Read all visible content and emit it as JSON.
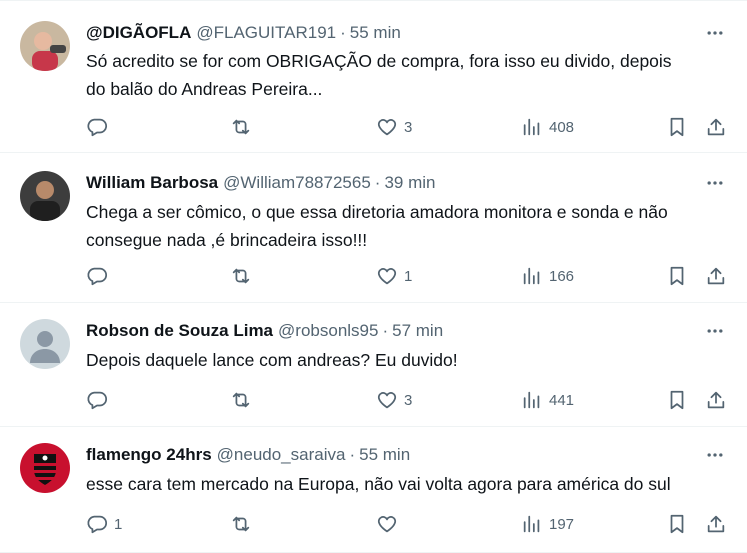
{
  "tweets": [
    {
      "name": "@DIGÃOFLA",
      "handle": "@FLAGUITAR191",
      "separator": "·",
      "time": "55 min",
      "lines": [
        "Só acredito se for com OBRIGAÇÃO de compra, fora isso eu divido, depois",
        "do balão do Andreas Pereira..."
      ],
      "replies": "",
      "retweets": "",
      "likes": "3",
      "views": "408",
      "avatar_colors": [
        "#c9b8a0",
        "#c7374a"
      ]
    },
    {
      "name": "William Barbosa",
      "handle": "@William78872565",
      "separator": "·",
      "time": "39 min",
      "lines": [
        "Chega a ser cômico, o que essa diretoria amadora monitora e sonda e não",
        "consegue nada ,é brincadeira isso!!!"
      ],
      "replies": "",
      "retweets": "",
      "likes": "1",
      "views": "166",
      "avatar_colors": [
        "#3d3d3d",
        "#1f1f1f"
      ]
    },
    {
      "name": "Robson de Souza Lima",
      "handle": "@robsonls95",
      "separator": "·",
      "time": "57 min",
      "lines": [
        "Depois daquele lance com andreas? Eu duvido!"
      ],
      "replies": "",
      "retweets": "",
      "likes": "3",
      "views": "441",
      "avatar_colors": [
        "#cfd9de",
        "#8b98a5"
      ]
    },
    {
      "name": "flamengo 24hrs",
      "handle": "@neudo_saraiva",
      "separator": "·",
      "time": "55 min",
      "lines": [
        "esse cara tem mercado na Europa, não vai volta agora para américa do sul"
      ],
      "replies": "1",
      "retweets": "",
      "likes": "",
      "views": "197",
      "avatar_colors": [
        "#c8102e",
        "#111111"
      ]
    }
  ]
}
